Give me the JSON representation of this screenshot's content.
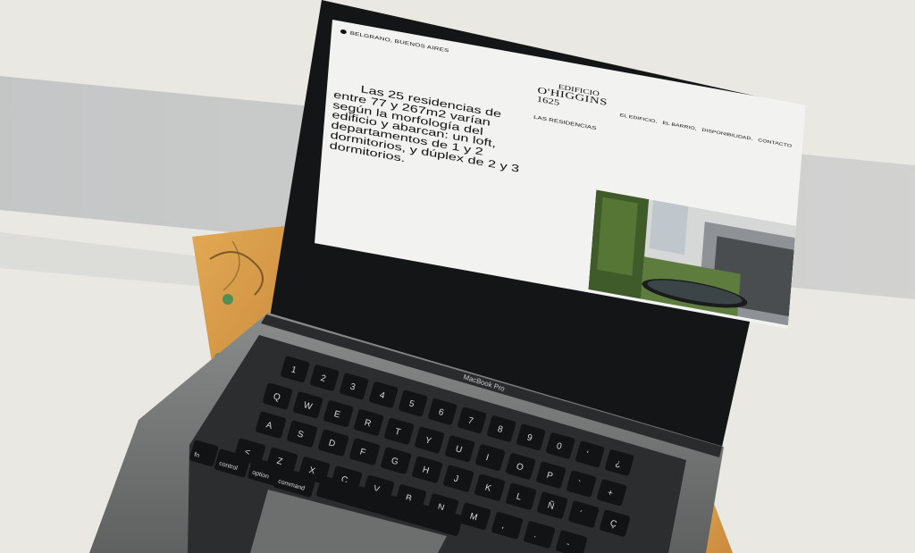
{
  "laptop": {
    "model_label": "MacBook Pro"
  },
  "website": {
    "location": "BELGRANO, BUENOS AIRES",
    "logo": {
      "line1": "EDIFICIO",
      "line2": "O'HIGGINS",
      "line3": "1625"
    },
    "nav": [
      "EL EDIFICIO,",
      "EL BARRIO,",
      "DISPONIBILIDAD,",
      "CONTACTO"
    ],
    "section_label": "LAS RESIDENCIAS",
    "intro_text": "Las 25 residencias de entre 77 y 267m2 varían según la morfología del edificio y abarcan: un loft, departamentos de 1 y 2 dormitorios, y dúplex de 2 y 3 dormitorios."
  },
  "keyboard": {
    "row_numbers": [
      "1",
      "2",
      "3",
      "4",
      "5",
      "6",
      "7",
      "8",
      "9",
      "0",
      "'",
      "¿"
    ],
    "row_q": [
      "Q",
      "W",
      "E",
      "R",
      "T",
      "Y",
      "U",
      "I",
      "O",
      "P",
      "`",
      "+"
    ],
    "row_a": [
      "A",
      "S",
      "D",
      "F",
      "G",
      "H",
      "J",
      "K",
      "L",
      "Ñ",
      "´",
      "Ç"
    ],
    "row_z": [
      "<",
      "Z",
      "X",
      "C",
      "V",
      "B",
      "N",
      "M",
      ",",
      ".",
      "-"
    ],
    "modifiers": {
      "fn": "fn",
      "control": "control",
      "option": "option",
      "command": "command"
    }
  },
  "colors": {
    "wall": "#e9e8e2",
    "laptop_body": "#7b7d7c",
    "bezel": "#141516",
    "screen_bg": "#f2f2f0",
    "stool_wood": "#d9a04e"
  }
}
